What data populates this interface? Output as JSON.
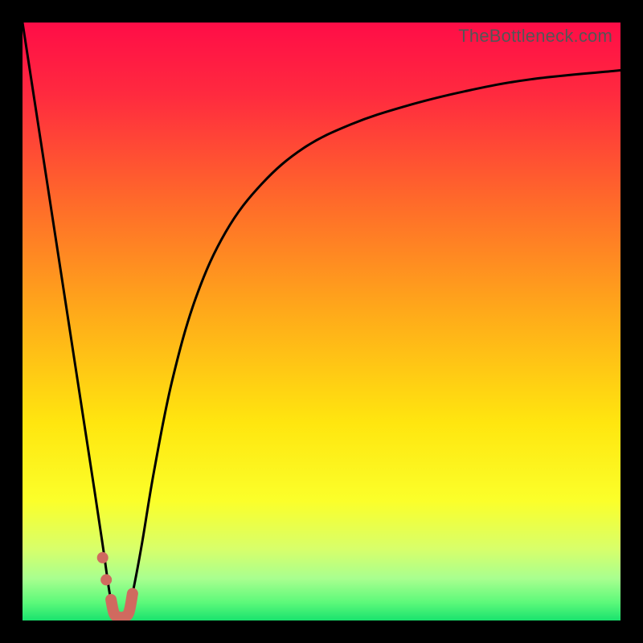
{
  "watermark": "TheBottleneck.com",
  "chart_data": {
    "type": "line",
    "title": "",
    "xlabel": "",
    "ylabel": "",
    "xlim": [
      0,
      100
    ],
    "ylim": [
      0,
      100
    ],
    "grid": false,
    "legend": false,
    "gradient_stops": [
      {
        "pos": 0.0,
        "color": "#ff0d47"
      },
      {
        "pos": 0.12,
        "color": "#ff2a3f"
      },
      {
        "pos": 0.3,
        "color": "#ff6a2a"
      },
      {
        "pos": 0.48,
        "color": "#ffa81a"
      },
      {
        "pos": 0.67,
        "color": "#ffe60f"
      },
      {
        "pos": 0.8,
        "color": "#fbff2a"
      },
      {
        "pos": 0.88,
        "color": "#d8ff6a"
      },
      {
        "pos": 0.93,
        "color": "#a8ff8f"
      },
      {
        "pos": 0.97,
        "color": "#5cf97a"
      },
      {
        "pos": 1.0,
        "color": "#19e36e"
      }
    ],
    "series": [
      {
        "name": "left-branch",
        "stroke": "#000000",
        "stroke_width": 3,
        "x": [
          0,
          2,
          4,
          6,
          8,
          10,
          12,
          13.5,
          14.5,
          15.3
        ],
        "y": [
          100,
          87,
          74,
          61,
          48,
          35,
          22,
          12,
          5,
          1
        ]
      },
      {
        "name": "right-branch",
        "stroke": "#000000",
        "stroke_width": 3,
        "x": [
          17.5,
          18.5,
          20,
          22,
          25,
          29,
          34,
          40,
          47,
          55,
          64,
          74,
          85,
          100
        ],
        "y": [
          1,
          5,
          13,
          25,
          40,
          54,
          65,
          73,
          79,
          83,
          86,
          88.5,
          90.5,
          92
        ]
      }
    ],
    "highlight_stroke": {
      "name": "valley-highlight",
      "color": "#d06a5f",
      "width": 14,
      "cap": "round",
      "x": [
        14.8,
        15.3,
        16.0,
        17.0,
        17.8,
        18.4
      ],
      "y": [
        3.5,
        1.2,
        0.6,
        0.6,
        1.4,
        4.5
      ]
    },
    "highlight_points": {
      "name": "valley-dots",
      "color": "#d06a5f",
      "radius": 7,
      "points": [
        {
          "x": 13.4,
          "y": 10.5
        },
        {
          "x": 14.0,
          "y": 6.8
        }
      ]
    }
  }
}
